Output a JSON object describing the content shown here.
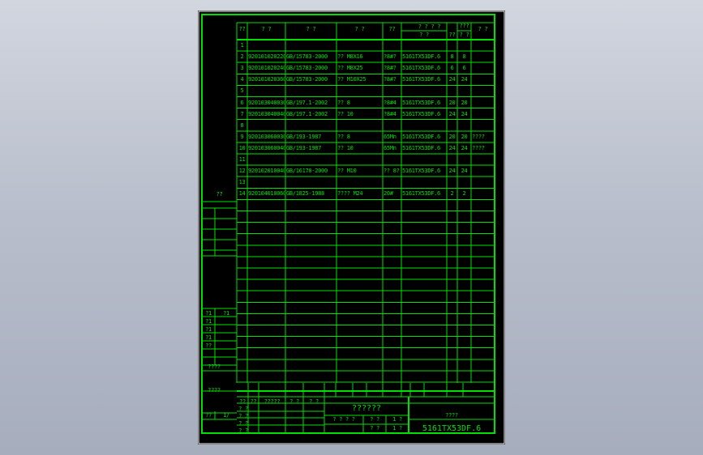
{
  "header": {
    "col_no": "??",
    "col_code": "?  ?",
    "col_std": "?  ?",
    "col_name": "?  ?",
    "col_qty": "??",
    "col_material": "? ? ? ?",
    "col_material_sub1": "?  ?",
    "col_material_sub2": "??",
    "col_weight": "???",
    "col_weight_sub": "? ?",
    "col_note": "?  ?"
  },
  "rows": [
    {
      "n": "1",
      "code": "",
      "std": "",
      "name": "",
      "qty": "",
      "material": "",
      "a": "",
      "b": "",
      "note": ""
    },
    {
      "n": "2",
      "code": "92010102022011",
      "std": "GB/15783-2000",
      "name": "?? M8X16",
      "qty": "?8#?",
      "material": "5161TX53DF.6",
      "a": "8",
      "b": "8",
      "note": ""
    },
    {
      "n": "3",
      "code": "92010102024011",
      "std": "GB/15783-2000",
      "name": "?? M8X25",
      "qty": "?8#?",
      "material": "5161TX53DF.6",
      "a": "6",
      "b": "6",
      "note": ""
    },
    {
      "n": "4",
      "code": "92010102036011",
      "std": "GB/15783-2000",
      "name": "?? M10X25",
      "qty": "?8#?",
      "material": "5161TX53DF.6",
      "a": "24",
      "b": "24",
      "note": ""
    },
    {
      "n": "5",
      "code": "",
      "std": "",
      "name": "",
      "qty": "",
      "material": "",
      "a": "",
      "b": "",
      "note": ""
    },
    {
      "n": "6",
      "code": "92010304003011",
      "std": "GB/197.1-2002",
      "name": "?? 8",
      "qty": "?8#4",
      "material": "5161TX53DF.6",
      "a": "20",
      "b": "20",
      "note": ""
    },
    {
      "n": "7",
      "code": "92010304004011",
      "std": "GB/197.1-2002",
      "name": "?? 10",
      "qty": "?8#4",
      "material": "5161TX53DF.6",
      "a": "24",
      "b": "24",
      "note": ""
    },
    {
      "n": "8",
      "code": "",
      "std": "",
      "name": "",
      "qty": "",
      "material": "",
      "a": "",
      "b": "",
      "note": ""
    },
    {
      "n": "9",
      "code": "92010306003011",
      "std": "GB/193-1987",
      "name": "?? 8",
      "qty": "65Mn",
      "material": "5161TX53DF.6",
      "a": "20",
      "b": "20",
      "note": "????"
    },
    {
      "n": "10",
      "code": "92010306004011",
      "std": "GB/193-1987",
      "name": "?? 10",
      "qty": "65Mn",
      "material": "5161TX53DF.6",
      "a": "24",
      "b": "24",
      "note": "????"
    },
    {
      "n": "11",
      "code": "",
      "std": "",
      "name": "",
      "qty": "",
      "material": "",
      "a": "",
      "b": "",
      "note": ""
    },
    {
      "n": "12",
      "code": "92010201004011",
      "std": "GB/16170-2000",
      "name": "?? M10",
      "qty": "?? 8?",
      "material": "5161TX53DF.6",
      "a": "24",
      "b": "24",
      "note": ""
    },
    {
      "n": "13",
      "code": "",
      "std": "",
      "name": "",
      "qty": "",
      "material": "",
      "a": "",
      "b": "",
      "note": ""
    },
    {
      "n": "14",
      "code": "92010401006011",
      "std": "GB/1825-1988",
      "name": "???? M24",
      "qty": "20#",
      "material": "5161TX53DF.6",
      "a": "2",
      "b": "2",
      "note": ""
    }
  ],
  "left_strip": {
    "mark": "??",
    "labels": [
      "?1",
      "?1",
      "?1",
      "?1",
      "??"
    ],
    "label2": "?1",
    "bottom1": "????",
    "bottom2": "????",
    "bottom3a": "??",
    "bottom3b": "1/"
  },
  "title_block": {
    "sign_labels": [
      "??",
      "??",
      "?????",
      "? ?",
      "? ?"
    ],
    "sign_rows": [
      "? ?",
      "? ?",
      "? ?",
      "? ?"
    ],
    "drawing_title": "??????",
    "stage_label": "? ? ? ?",
    "scale_label": "? ?",
    "scale_value": "1 ?",
    "sheet_label": "? ?",
    "sheet_value": "1 ?",
    "company": "????",
    "drawing_number": "5161TX53DF.6"
  },
  "colors": {
    "line": "#00e000",
    "sheet": "#000000",
    "frame": "#ffffff"
  }
}
